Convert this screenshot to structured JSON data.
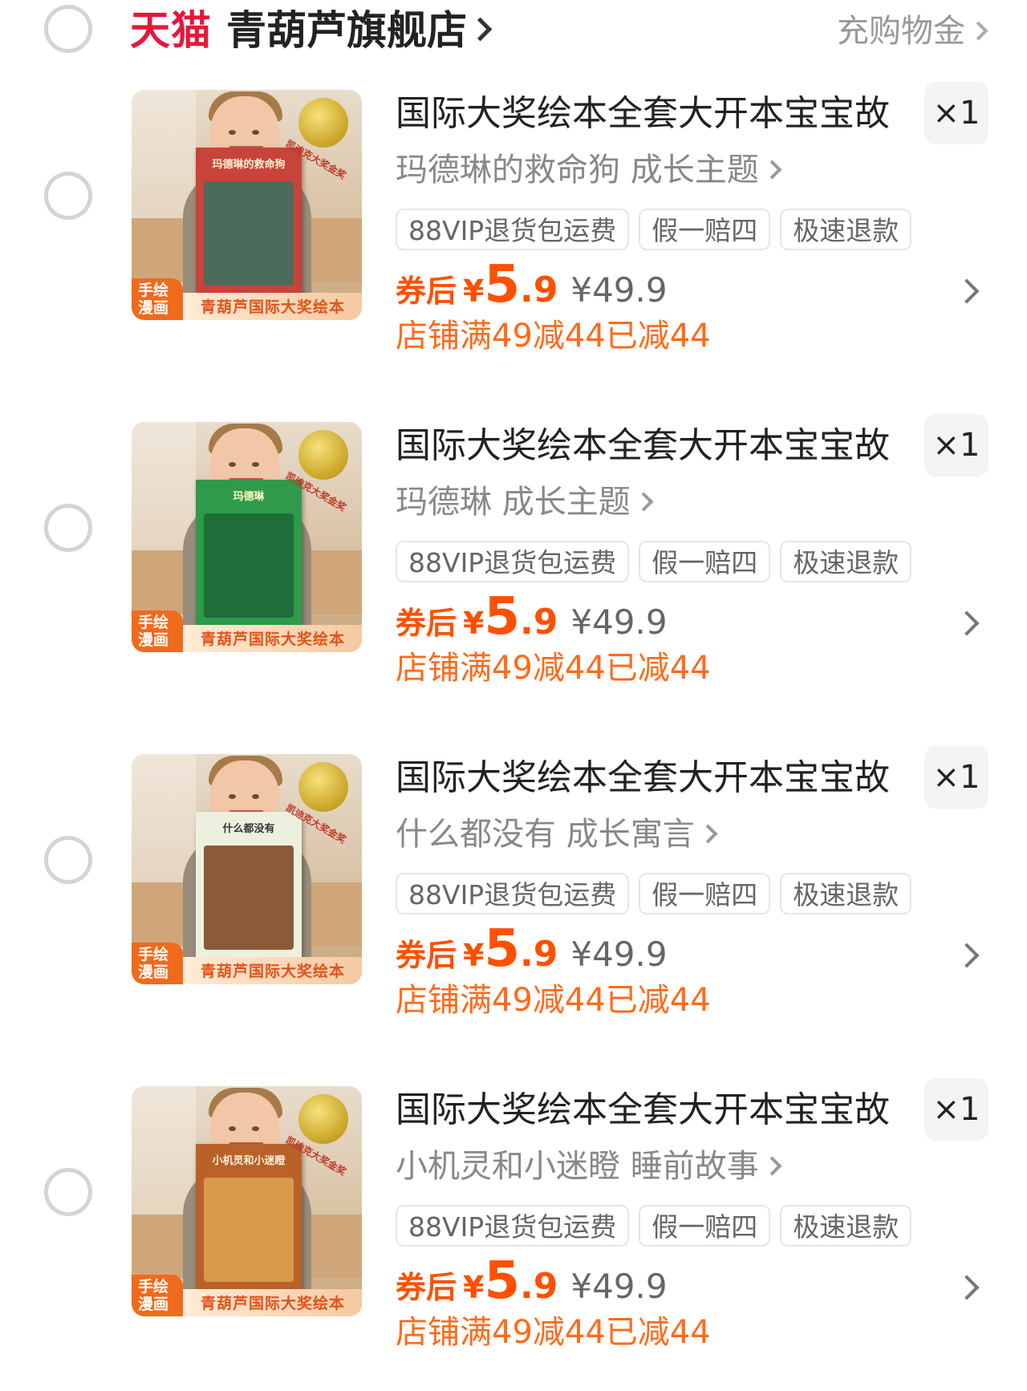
{
  "store": {
    "brand": "天猫",
    "name": "青葫芦旗舰店",
    "recharge_label": "充购物金"
  },
  "products": [
    {
      "title": "国际大奖绘本全套大开本宝宝故",
      "sku": "玛德琳的救命狗 成长主题",
      "quantity": "×1",
      "tags": [
        "88VIP退货包运费",
        "假一赔四",
        "极速退款"
      ],
      "coupon_label": "券后",
      "currency": "¥",
      "price_int": "5",
      "price_dec": ".9",
      "original_price": "¥49.9",
      "discount_text": "店铺满49减44已减44",
      "image": {
        "book_title": "玛德琳的救命狗",
        "corner_tag": "手绘漫画",
        "banner": "青葫芦国际大奖绘本",
        "medal_text": "凯迪克大奖金奖",
        "book_color": "#c8433a",
        "art_color": "#4d6b5a",
        "title_color": "#fff3d6"
      }
    },
    {
      "title": "国际大奖绘本全套大开本宝宝故",
      "sku": "玛德琳 成长主题",
      "quantity": "×1",
      "tags": [
        "88VIP退货包运费",
        "假一赔四",
        "极速退款"
      ],
      "coupon_label": "券后",
      "currency": "¥",
      "price_int": "5",
      "price_dec": ".9",
      "original_price": "¥49.9",
      "discount_text": "店铺满49减44已减44",
      "image": {
        "book_title": "玛德琳",
        "corner_tag": "手绘漫画",
        "banner": "青葫芦国际大奖绘本",
        "medal_text": "凯迪克大奖金奖",
        "book_color": "#2f9a4a",
        "art_color": "#1f6e3a",
        "title_color": "#fff8c0"
      }
    },
    {
      "title": "国际大奖绘本全套大开本宝宝故",
      "sku": "什么都没有 成长寓言",
      "quantity": "×1",
      "tags": [
        "88VIP退货包运费",
        "假一赔四",
        "极速退款"
      ],
      "coupon_label": "券后",
      "currency": "¥",
      "price_int": "5",
      "price_dec": ".9",
      "original_price": "¥49.9",
      "discount_text": "店铺满49减44已减44",
      "image": {
        "book_title": "什么都没有",
        "corner_tag": "手绘漫画",
        "banner": "青葫芦国际大奖绘本",
        "medal_text": "凯迪克大奖金奖",
        "book_color": "#eef0df",
        "art_color": "#8a5a3a",
        "title_color": "#333333"
      }
    },
    {
      "title": "国际大奖绘本全套大开本宝宝故",
      "sku": "小机灵和小迷瞪 睡前故事",
      "quantity": "×1",
      "tags": [
        "88VIP退货包运费",
        "假一赔四",
        "极速退款"
      ],
      "coupon_label": "券后",
      "currency": "¥",
      "price_int": "5",
      "price_dec": ".9",
      "original_price": "¥49.9",
      "discount_text": "店铺满49减44已减44",
      "image": {
        "book_title": "小机灵和小迷瞪",
        "corner_tag": "手绘漫画",
        "banner": "青葫芦国际大奖绘本",
        "medal_text": "凯迪克大奖金奖",
        "book_color": "#b8622a",
        "art_color": "#d99a4a",
        "title_color": "#fff1d8"
      }
    }
  ]
}
